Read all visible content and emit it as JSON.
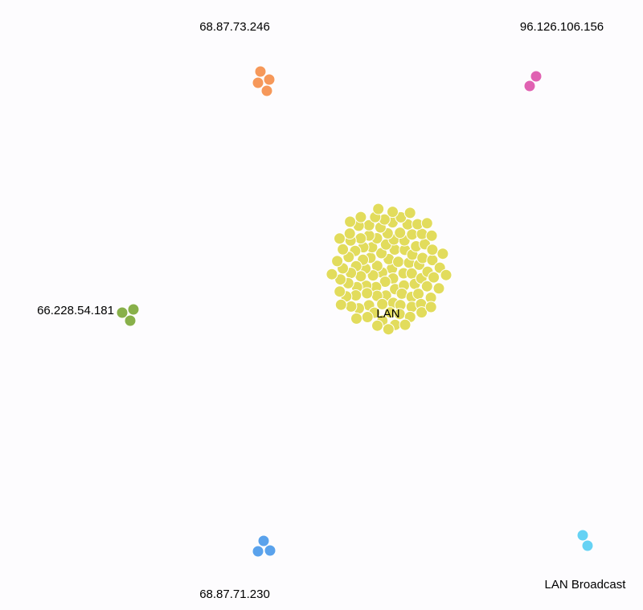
{
  "graph": {
    "groups": [
      {
        "id": "g-68-87-73-246",
        "label": "68.87.73.246",
        "color": "#f6985a",
        "node_count": 4
      },
      {
        "id": "g-96-126-106-156",
        "label": "96.126.106.156",
        "color": "#e062b2",
        "node_count": 2
      },
      {
        "id": "g-lan",
        "label": "LAN",
        "color": "#e2dc5c",
        "node_count": 112
      },
      {
        "id": "g-66-228-54-181",
        "label": "66.228.54.181",
        "color": "#88b04a",
        "node_count": 3
      },
      {
        "id": "g-68-87-71-230",
        "label": "68.87.71.230",
        "color": "#5aa2ec",
        "node_count": 3
      },
      {
        "id": "g-lan-broadcast",
        "label": "LAN Broadcast",
        "color": "#66d2f4",
        "node_count": 2
      }
    ]
  }
}
